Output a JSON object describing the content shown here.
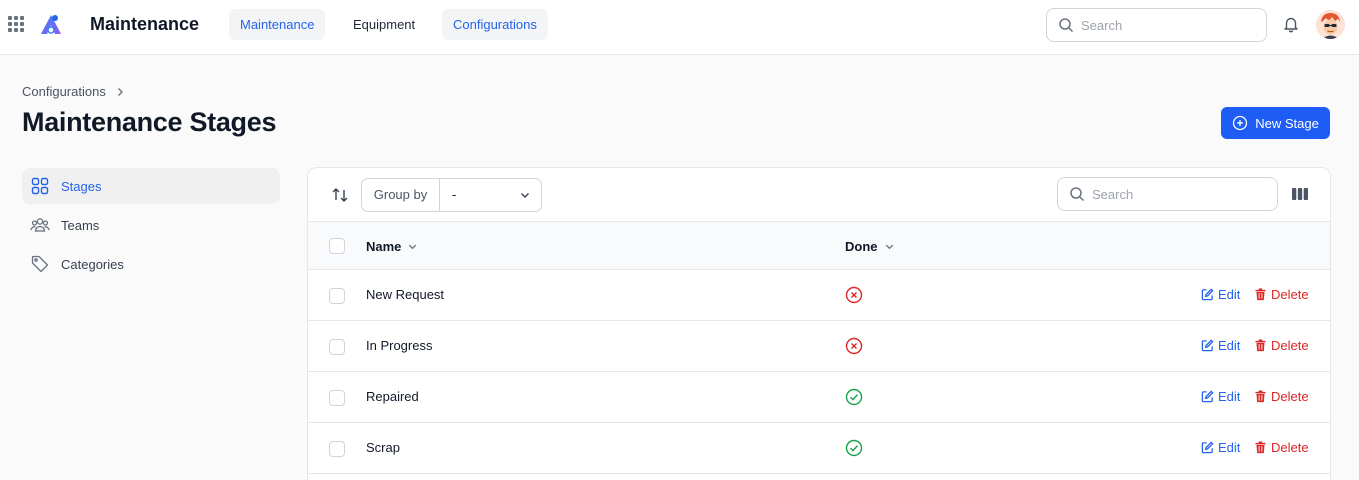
{
  "topbar": {
    "app_title": "Maintenance",
    "tabs": [
      {
        "label": "Maintenance"
      },
      {
        "label": "Equipment"
      },
      {
        "label": "Configurations"
      }
    ],
    "search_placeholder": "Search"
  },
  "header": {
    "breadcrumb": "Configurations",
    "title": "Maintenance Stages",
    "new_button": "New Stage"
  },
  "sidebar": {
    "items": [
      {
        "label": "Stages",
        "icon": "grid-icon",
        "active": true
      },
      {
        "label": "Teams",
        "icon": "users-icon",
        "active": false
      },
      {
        "label": "Categories",
        "icon": "tag-icon",
        "active": false
      }
    ]
  },
  "toolbar": {
    "group_by_label": "Group by",
    "group_by_value": "-",
    "search_placeholder": "Search"
  },
  "table": {
    "columns": [
      {
        "label": "Name"
      },
      {
        "label": "Done"
      }
    ],
    "rows": [
      {
        "name": "New Request",
        "done": false
      },
      {
        "name": "In Progress",
        "done": false
      },
      {
        "name": "Repaired",
        "done": true
      },
      {
        "name": "Scrap",
        "done": true
      }
    ],
    "edit_label": "Edit",
    "delete_label": "Delete"
  },
  "colors": {
    "accent": "#1d5cf5",
    "link": "#2563eb",
    "danger": "#dc2626",
    "success": "#16a34a"
  }
}
